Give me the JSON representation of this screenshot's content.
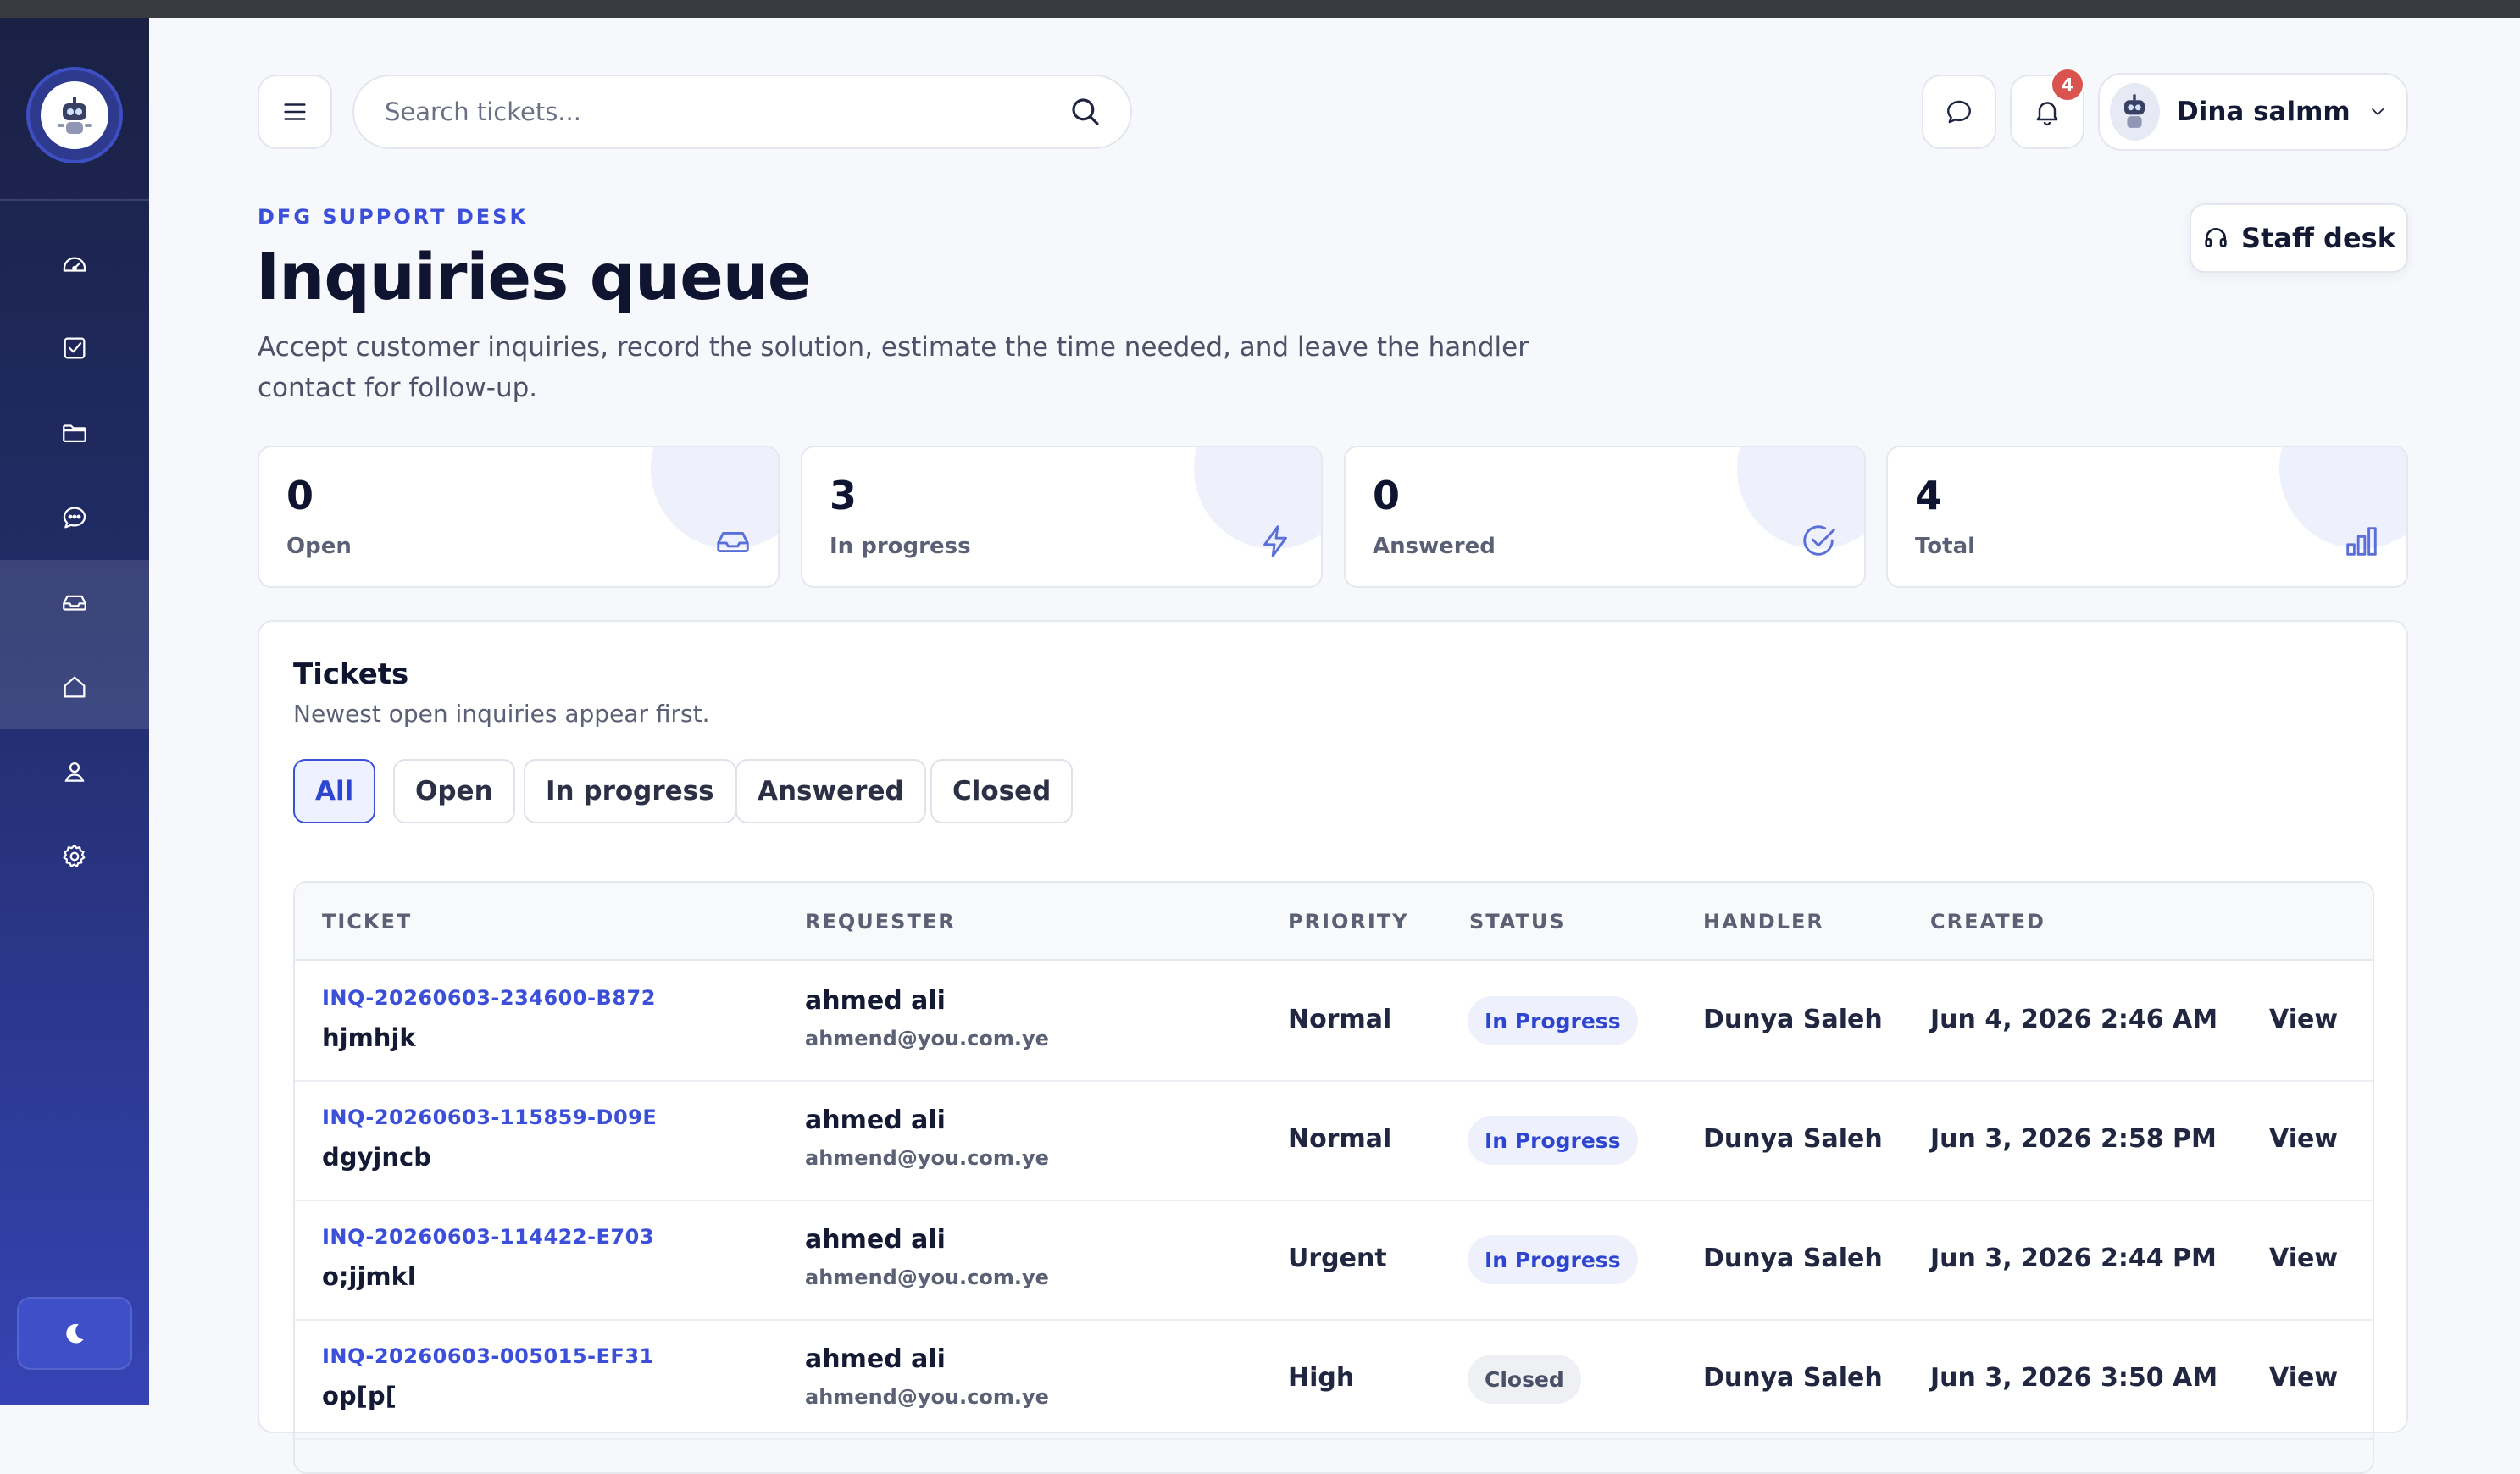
{
  "header": {
    "search_placeholder": "Search tickets...",
    "notification_count": "4",
    "user_name": "Dina salmm"
  },
  "page": {
    "eyebrow": "DFG SUPPORT DESK",
    "title": "Inquiries queue",
    "description": "Accept customer inquiries, record the solution, estimate the time needed, and leave the handler contact for follow-up.",
    "staff_button": "Staff desk"
  },
  "stats": [
    {
      "value": "0",
      "label": "Open",
      "icon": "inbox-icon"
    },
    {
      "value": "3",
      "label": "In progress",
      "icon": "lightning-icon"
    },
    {
      "value": "0",
      "label": "Answered",
      "icon": "check-circle-icon"
    },
    {
      "value": "4",
      "label": "Total",
      "icon": "bar-chart-icon"
    }
  ],
  "tickets": {
    "title": "Tickets",
    "subtitle": "Newest open inquiries appear first.",
    "filters": [
      "All",
      "Open",
      "In progress",
      "Answered",
      "Closed"
    ],
    "active_filter": "All",
    "columns": [
      "TICKET",
      "REQUESTER",
      "PRIORITY",
      "STATUS",
      "HANDLER",
      "CREATED"
    ],
    "rows": [
      {
        "id": "INQ-20260603-234600-B872",
        "subject": "hjmhjk",
        "requester": "ahmed ali",
        "email": "ahmend@you.com.ye",
        "priority": "Normal",
        "status": "In Progress",
        "handler": "Dunya Saleh",
        "created": "Jun 4, 2026 2:46 AM",
        "action": "View"
      },
      {
        "id": "INQ-20260603-115859-D09E",
        "subject": "dgyjncb",
        "requester": "ahmed ali",
        "email": "ahmend@you.com.ye",
        "priority": "Normal",
        "status": "In Progress",
        "handler": "Dunya Saleh",
        "created": "Jun 3, 2026 2:58 PM",
        "action": "View"
      },
      {
        "id": "INQ-20260603-114422-E703",
        "subject": "o;jjmkl",
        "requester": "ahmed ali",
        "email": "ahmend@you.com.ye",
        "priority": "Urgent",
        "status": "In Progress",
        "handler": "Dunya Saleh",
        "created": "Jun 3, 2026 2:44 PM",
        "action": "View"
      },
      {
        "id": "INQ-20260603-005015-EF31",
        "subject": "op[p[",
        "requester": "ahmed ali",
        "email": "ahmend@you.com.ye",
        "priority": "High",
        "status": "Closed",
        "handler": "Dunya Saleh",
        "created": "Jun 3, 2026 3:50 AM",
        "action": "View"
      }
    ]
  },
  "sidebar": {
    "items": [
      {
        "icon": "dashboard-gauge-icon"
      },
      {
        "icon": "checkbox-icon"
      },
      {
        "icon": "folder-icon"
      },
      {
        "icon": "chat-icon"
      },
      {
        "icon": "inbox-icon"
      },
      {
        "icon": "home-icon"
      },
      {
        "icon": "user-icon"
      },
      {
        "icon": "settings-icon"
      }
    ],
    "active_items": [
      "inbox-icon",
      "home-icon"
    ],
    "theme_toggle_icon": "moon-icon"
  },
  "colors": {
    "accent": "#3b4fd8",
    "sidebar_top": "#1a2144",
    "sidebar_bottom": "#3643b4",
    "badge": "#d9534f"
  }
}
